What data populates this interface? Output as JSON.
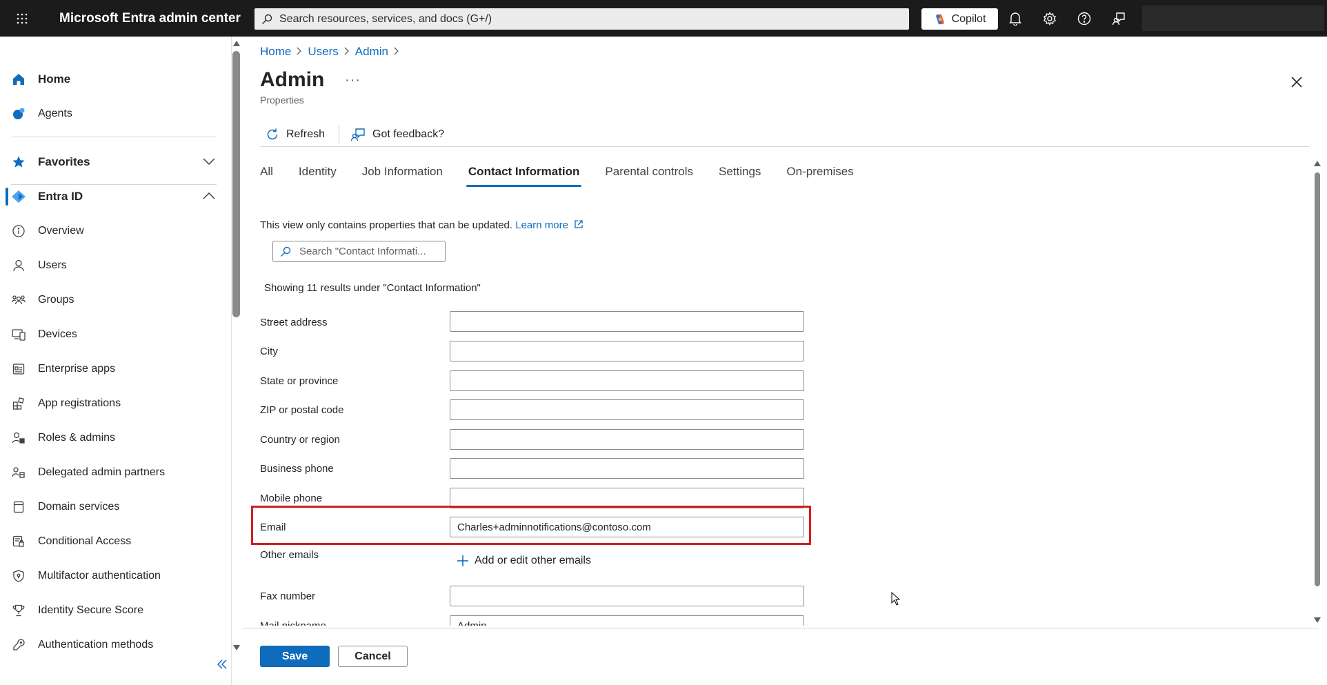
{
  "topbar": {
    "title": "Microsoft Entra admin center",
    "search_placeholder": "Search resources, services, and docs (G+/)",
    "copilot_label": "Copilot"
  },
  "sidebar": {
    "home": "Home",
    "agents": "Agents",
    "favorites": "Favorites",
    "entra_id": "Entra ID",
    "items": [
      {
        "label": "Overview",
        "icon": "info-icon"
      },
      {
        "label": "Users",
        "icon": "user-icon"
      },
      {
        "label": "Groups",
        "icon": "groups-icon"
      },
      {
        "label": "Devices",
        "icon": "devices-icon"
      },
      {
        "label": "Enterprise apps",
        "icon": "enterprise-apps-icon"
      },
      {
        "label": "App registrations",
        "icon": "app-registrations-icon"
      },
      {
        "label": "Roles & admins",
        "icon": "roles-icon"
      },
      {
        "label": "Delegated admin partners",
        "icon": "partners-icon"
      },
      {
        "label": "Domain services",
        "icon": "domain-icon"
      },
      {
        "label": "Conditional Access",
        "icon": "conditional-access-icon"
      },
      {
        "label": "Multifactor authentication",
        "icon": "shield-icon"
      },
      {
        "label": "Identity Secure Score",
        "icon": "trophy-icon"
      },
      {
        "label": "Authentication methods",
        "icon": "key-icon"
      }
    ]
  },
  "breadcrumb": [
    "Home",
    "Users",
    "Admin"
  ],
  "page": {
    "title": "Admin",
    "more": "···",
    "subtitle": "Properties"
  },
  "toolbar": {
    "refresh": "Refresh",
    "feedback": "Got feedback?"
  },
  "tabs": [
    "All",
    "Identity",
    "Job Information",
    "Contact Information",
    "Parental controls",
    "Settings",
    "On-premises"
  ],
  "info": {
    "text": "This view only contains properties that can be updated.",
    "link": "Learn more"
  },
  "filter": {
    "placeholder": "Search \"Contact Informati..."
  },
  "showing": "Showing 11 results under \"Contact Information\"",
  "fields": {
    "street": {
      "label": "Street address",
      "value": ""
    },
    "city": {
      "label": "City",
      "value": ""
    },
    "state": {
      "label": "State or province",
      "value": ""
    },
    "zip": {
      "label": "ZIP or postal code",
      "value": ""
    },
    "country": {
      "label": "Country or region",
      "value": ""
    },
    "business_phone": {
      "label": "Business phone",
      "value": ""
    },
    "mobile_phone": {
      "label": "Mobile phone",
      "value": ""
    },
    "email": {
      "label": "Email",
      "value": "Charles+adminnotifications@contoso.com"
    },
    "other_emails": {
      "label": "Other emails",
      "action": "Add or edit other emails"
    },
    "fax": {
      "label": "Fax number",
      "value": ""
    },
    "mail_nickname": {
      "label": "Mail nickname",
      "value": "Admin"
    }
  },
  "footer": {
    "save": "Save",
    "cancel": "Cancel"
  }
}
